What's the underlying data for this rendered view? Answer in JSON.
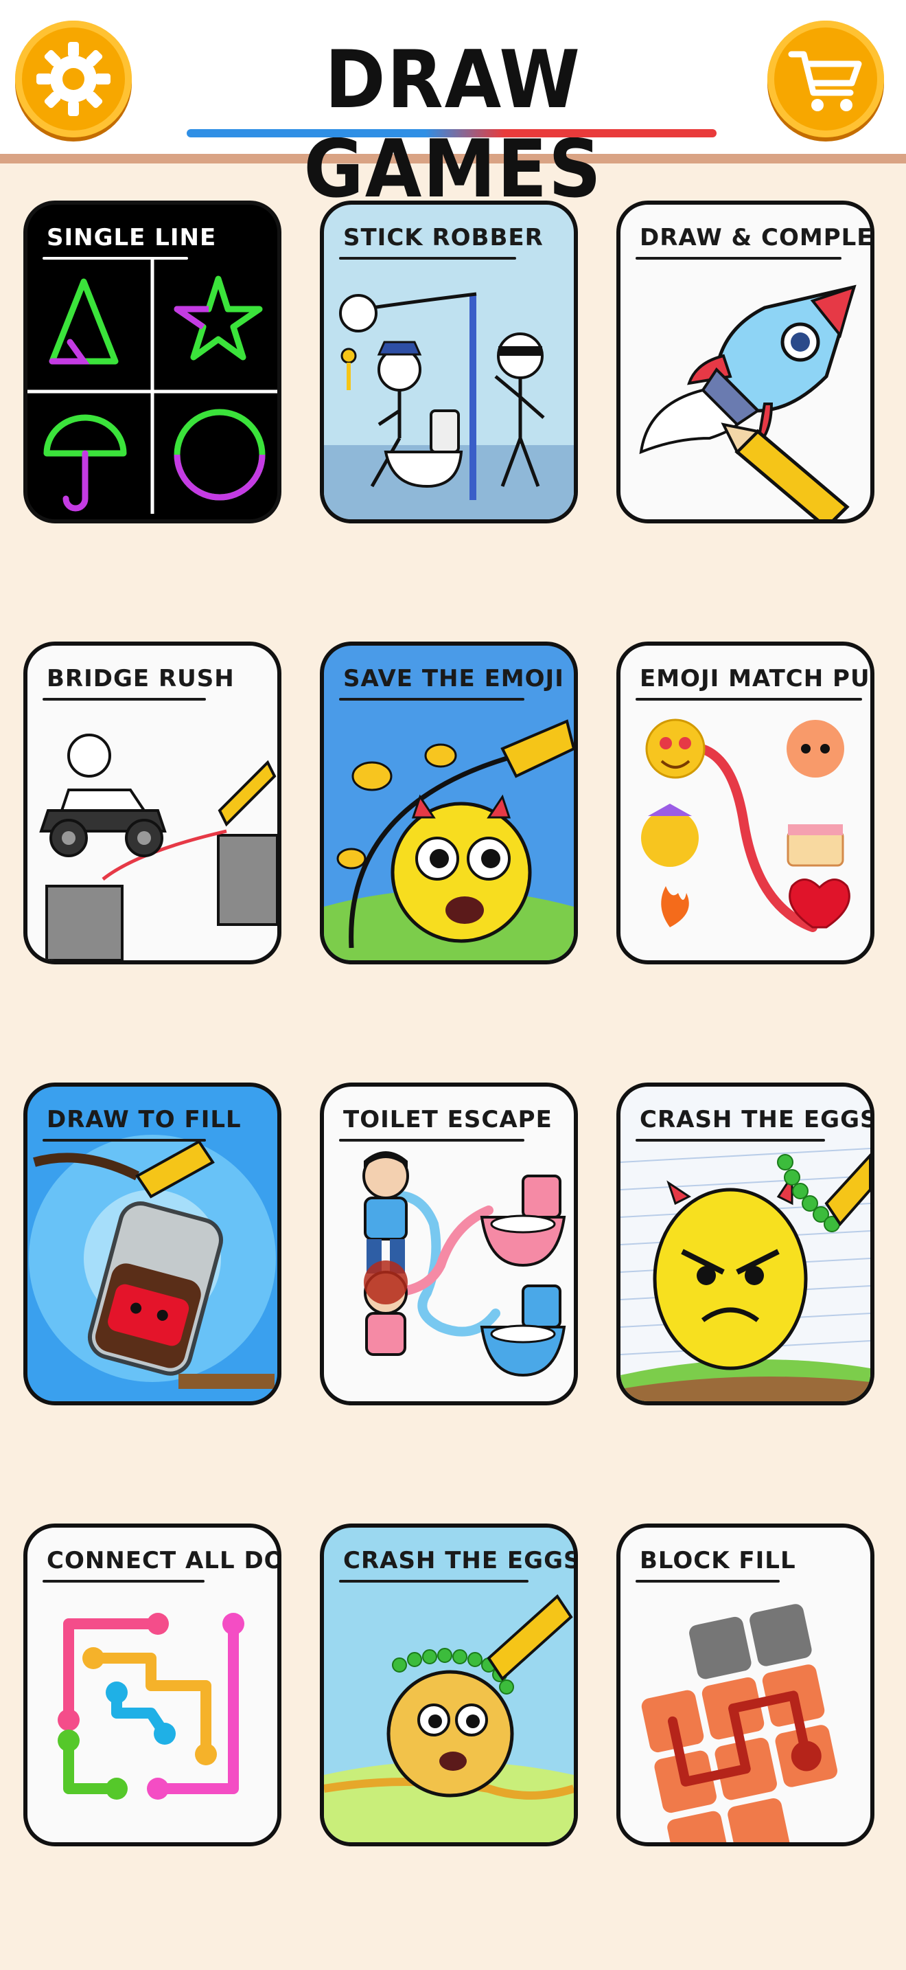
{
  "header": {
    "title": "DRAW GAMES",
    "settings_icon": "gear-icon",
    "shop_icon": "shopping-cart-icon"
  },
  "colors": {
    "background": "#fbefe0",
    "accent_orange": "#f7a700",
    "underline_blue": "#2f8fe5",
    "underline_red": "#e93b3b"
  },
  "games": [
    {
      "label": "SINGLE LINE"
    },
    {
      "label": "STICK ROBBER"
    },
    {
      "label": "DRAW & COMPLETE"
    },
    {
      "label": "BRIDGE RUSH"
    },
    {
      "label": "SAVE THE EMOJI"
    },
    {
      "label": "EMOJI MATCH PUZZLE"
    },
    {
      "label": "DRAW TO FILL"
    },
    {
      "label": "TOILET ESCAPE"
    },
    {
      "label": "CRASH THE EGGS"
    },
    {
      "label": "CONNECT ALL DOTS"
    },
    {
      "label": "CRASH THE EGGS"
    },
    {
      "label": "BLOCK FILL"
    }
  ]
}
